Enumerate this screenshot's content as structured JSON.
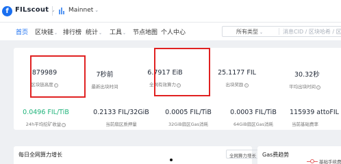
{
  "app": {
    "logo_letter": "f",
    "name": "FILscout"
  },
  "network": {
    "name": "Mainnet"
  },
  "nav": {
    "items": [
      "首页",
      "区块链",
      "排行榜",
      "统计",
      "工具",
      "节点地图",
      "个人中心"
    ],
    "search_type": "所有类型",
    "search_placeholder": "消息CID / 区块哈希 / 区块高"
  },
  "stats": [
    {
      "value": "879989",
      "label": "区块链高度"
    },
    {
      "value": "7秒前",
      "label": "最新出块时间"
    },
    {
      "value": "6.7917 EiB",
      "label": "全网有效算力"
    },
    {
      "value": "25.1177 FIL",
      "label": "出块奖励"
    },
    {
      "value": "30.32秒",
      "label": "平均出块时间"
    },
    {
      "value": "0.0496 FIL/TiB",
      "label": "24h平均挖矿收益",
      "color": "#1fb37a"
    },
    {
      "value": "0.2133 FIL/32GiB",
      "label": "当前扇区质押量"
    },
    {
      "value": "0.0005 FIL/TiB",
      "label": "32GiB扇区Gas消耗"
    },
    {
      "value": "0.0003 FIL/TiB",
      "label": "64GiB扇区Gas消耗"
    },
    {
      "value": "115939 attoFIL",
      "label": "当前基础费率"
    }
  ],
  "panels": {
    "power_growth": {
      "title": "每日全网算力增长",
      "select": "全网算力增长"
    },
    "gas": {
      "title": "Gas费趋势",
      "legend": "基础手续费率"
    }
  },
  "colors": {
    "accent": "#1a6ff0",
    "highlight_box": "#e02020",
    "positive": "#1fb37a"
  }
}
